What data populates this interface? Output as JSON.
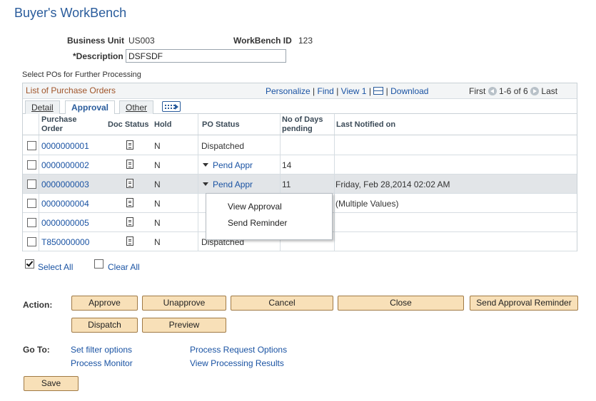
{
  "page": {
    "title": "Buyer's WorkBench"
  },
  "header": {
    "business_unit_label": "Business Unit",
    "business_unit_value": "US003",
    "workbench_id_label": "WorkBench ID",
    "workbench_id_value": "123",
    "description_label": "*Description",
    "description_value": "DSFSDF"
  },
  "grid": {
    "section_label": "Select POs for Further Processing",
    "title": "List of Purchase Orders",
    "nav": {
      "personalize": "Personalize",
      "sep": "|",
      "find": "Find",
      "view1": "View 1",
      "download": "Download"
    },
    "pager": {
      "first": "First",
      "range": "1-6 of 6",
      "last": "Last"
    },
    "tabs": {
      "detail": "Detail",
      "approval": "Approval",
      "other": "Other"
    },
    "columns": {
      "po": "Purchase Order",
      "doc_status": "Doc Status",
      "hold": "Hold",
      "po_status": "PO Status",
      "days": "No of Days pending",
      "last_notified": "Last Notified on"
    },
    "rows": [
      {
        "po": "0000000001",
        "hold": "N",
        "status": "Dispatched",
        "days": "",
        "notified": ""
      },
      {
        "po": "0000000002",
        "hold": "N",
        "status": "Pend Appr",
        "days": "14",
        "notified": ""
      },
      {
        "po": "0000000003",
        "hold": "N",
        "status": "Pend Appr",
        "days": "11",
        "notified": "Friday, Feb 28,2014 02:02 AM"
      },
      {
        "po": "0000000004",
        "hold": "N",
        "status": "",
        "days": "",
        "notified": "(Multiple Values)"
      },
      {
        "po": "0000000005",
        "hold": "N",
        "status": "",
        "days": "",
        "notified": ""
      },
      {
        "po": "T850000000",
        "hold": "N",
        "status": "Dispatched",
        "days": "",
        "notified": ""
      }
    ]
  },
  "popup": {
    "view_approval": "View Approval",
    "send_reminder": "Send Reminder"
  },
  "selection": {
    "select_all": "Select All",
    "clear_all": "Clear All"
  },
  "actions": {
    "label": "Action:",
    "approve": "Approve",
    "unapprove": "Unapprove",
    "cancel": "Cancel",
    "close": "Close",
    "send_reminder": "Send Approval Reminder",
    "dispatch": "Dispatch",
    "preview": "Preview"
  },
  "goto": {
    "label": "Go To:",
    "set_filter": "Set filter options",
    "process_request": "Process Request Options",
    "process_monitor": "Process Monitor",
    "view_results": "View Processing Results"
  },
  "footer": {
    "save": "Save"
  }
}
